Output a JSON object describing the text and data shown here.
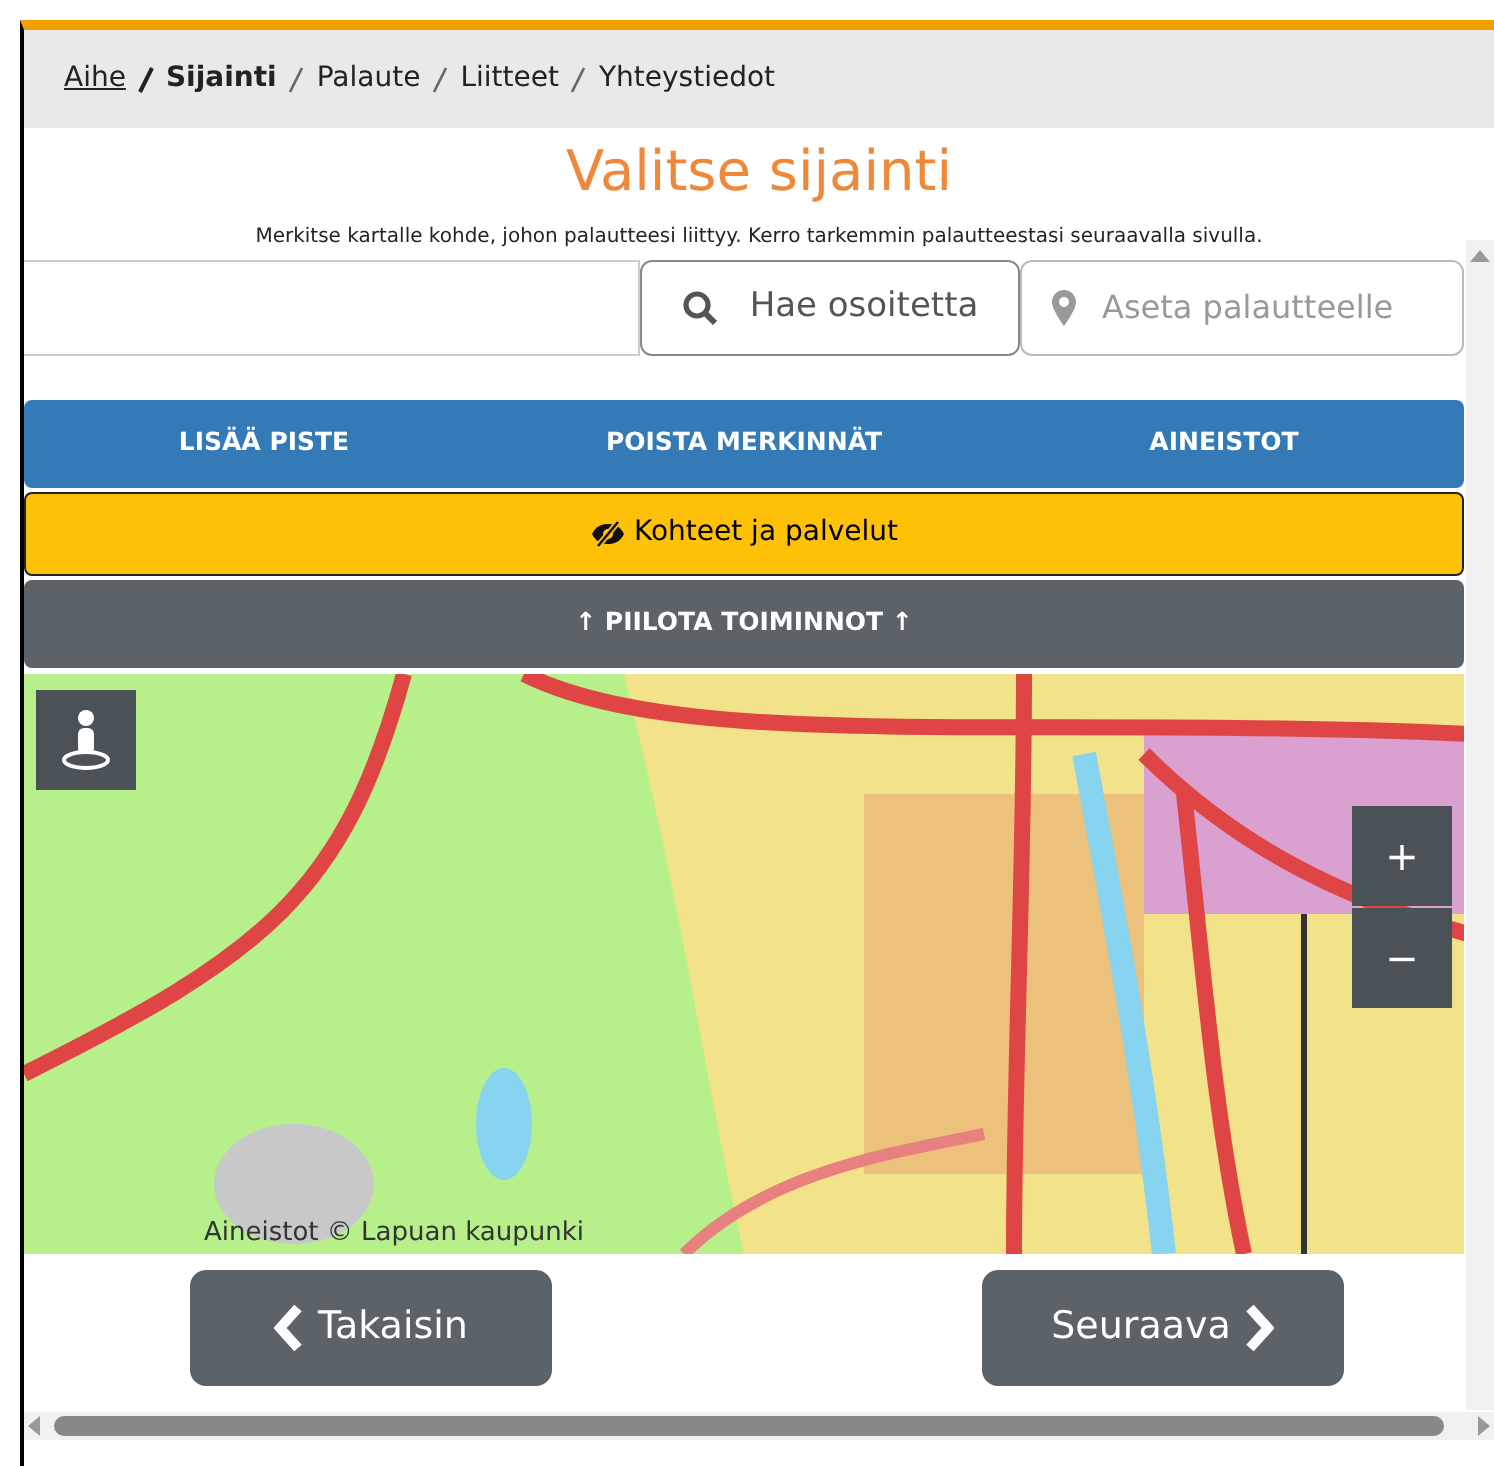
{
  "breadcrumb": [
    {
      "label": "Aihe",
      "link": true,
      "selected": false
    },
    {
      "label": "Sijainti",
      "link": false,
      "selected": true
    },
    {
      "label": "Palaute",
      "link": false,
      "selected": false
    },
    {
      "label": "Liitteet",
      "link": false,
      "selected": false
    },
    {
      "label": "Yhteystiedot",
      "link": false,
      "selected": false
    }
  ],
  "title": "Valitse sijainti",
  "instructions": "Merkitse kartalle kohde, johon palautteesi liittyy. Kerro tarkemmin palautteestasi seuraavalla sivulla.",
  "search": {
    "address_button": "Hae osoitetta",
    "location_placeholder": "Aseta palautteelle"
  },
  "toolbar": [
    "LISÄÄ PISTE",
    "POISTA MERKINNÄT",
    "AINEISTOT"
  ],
  "layers_button": "Kohteet ja palvelut",
  "hide_button": {
    "arrow_before": "↑",
    "label": "PIILOTA TOIMINNOT",
    "arrow_after": "↑"
  },
  "map": {
    "kind": "picture",
    "zoom_in": "+",
    "zoom_out": "−",
    "attribution": "Aineistot © Lapuan kaupunki"
  },
  "nav": {
    "back": "Takaisin",
    "next": "Seuraava"
  }
}
